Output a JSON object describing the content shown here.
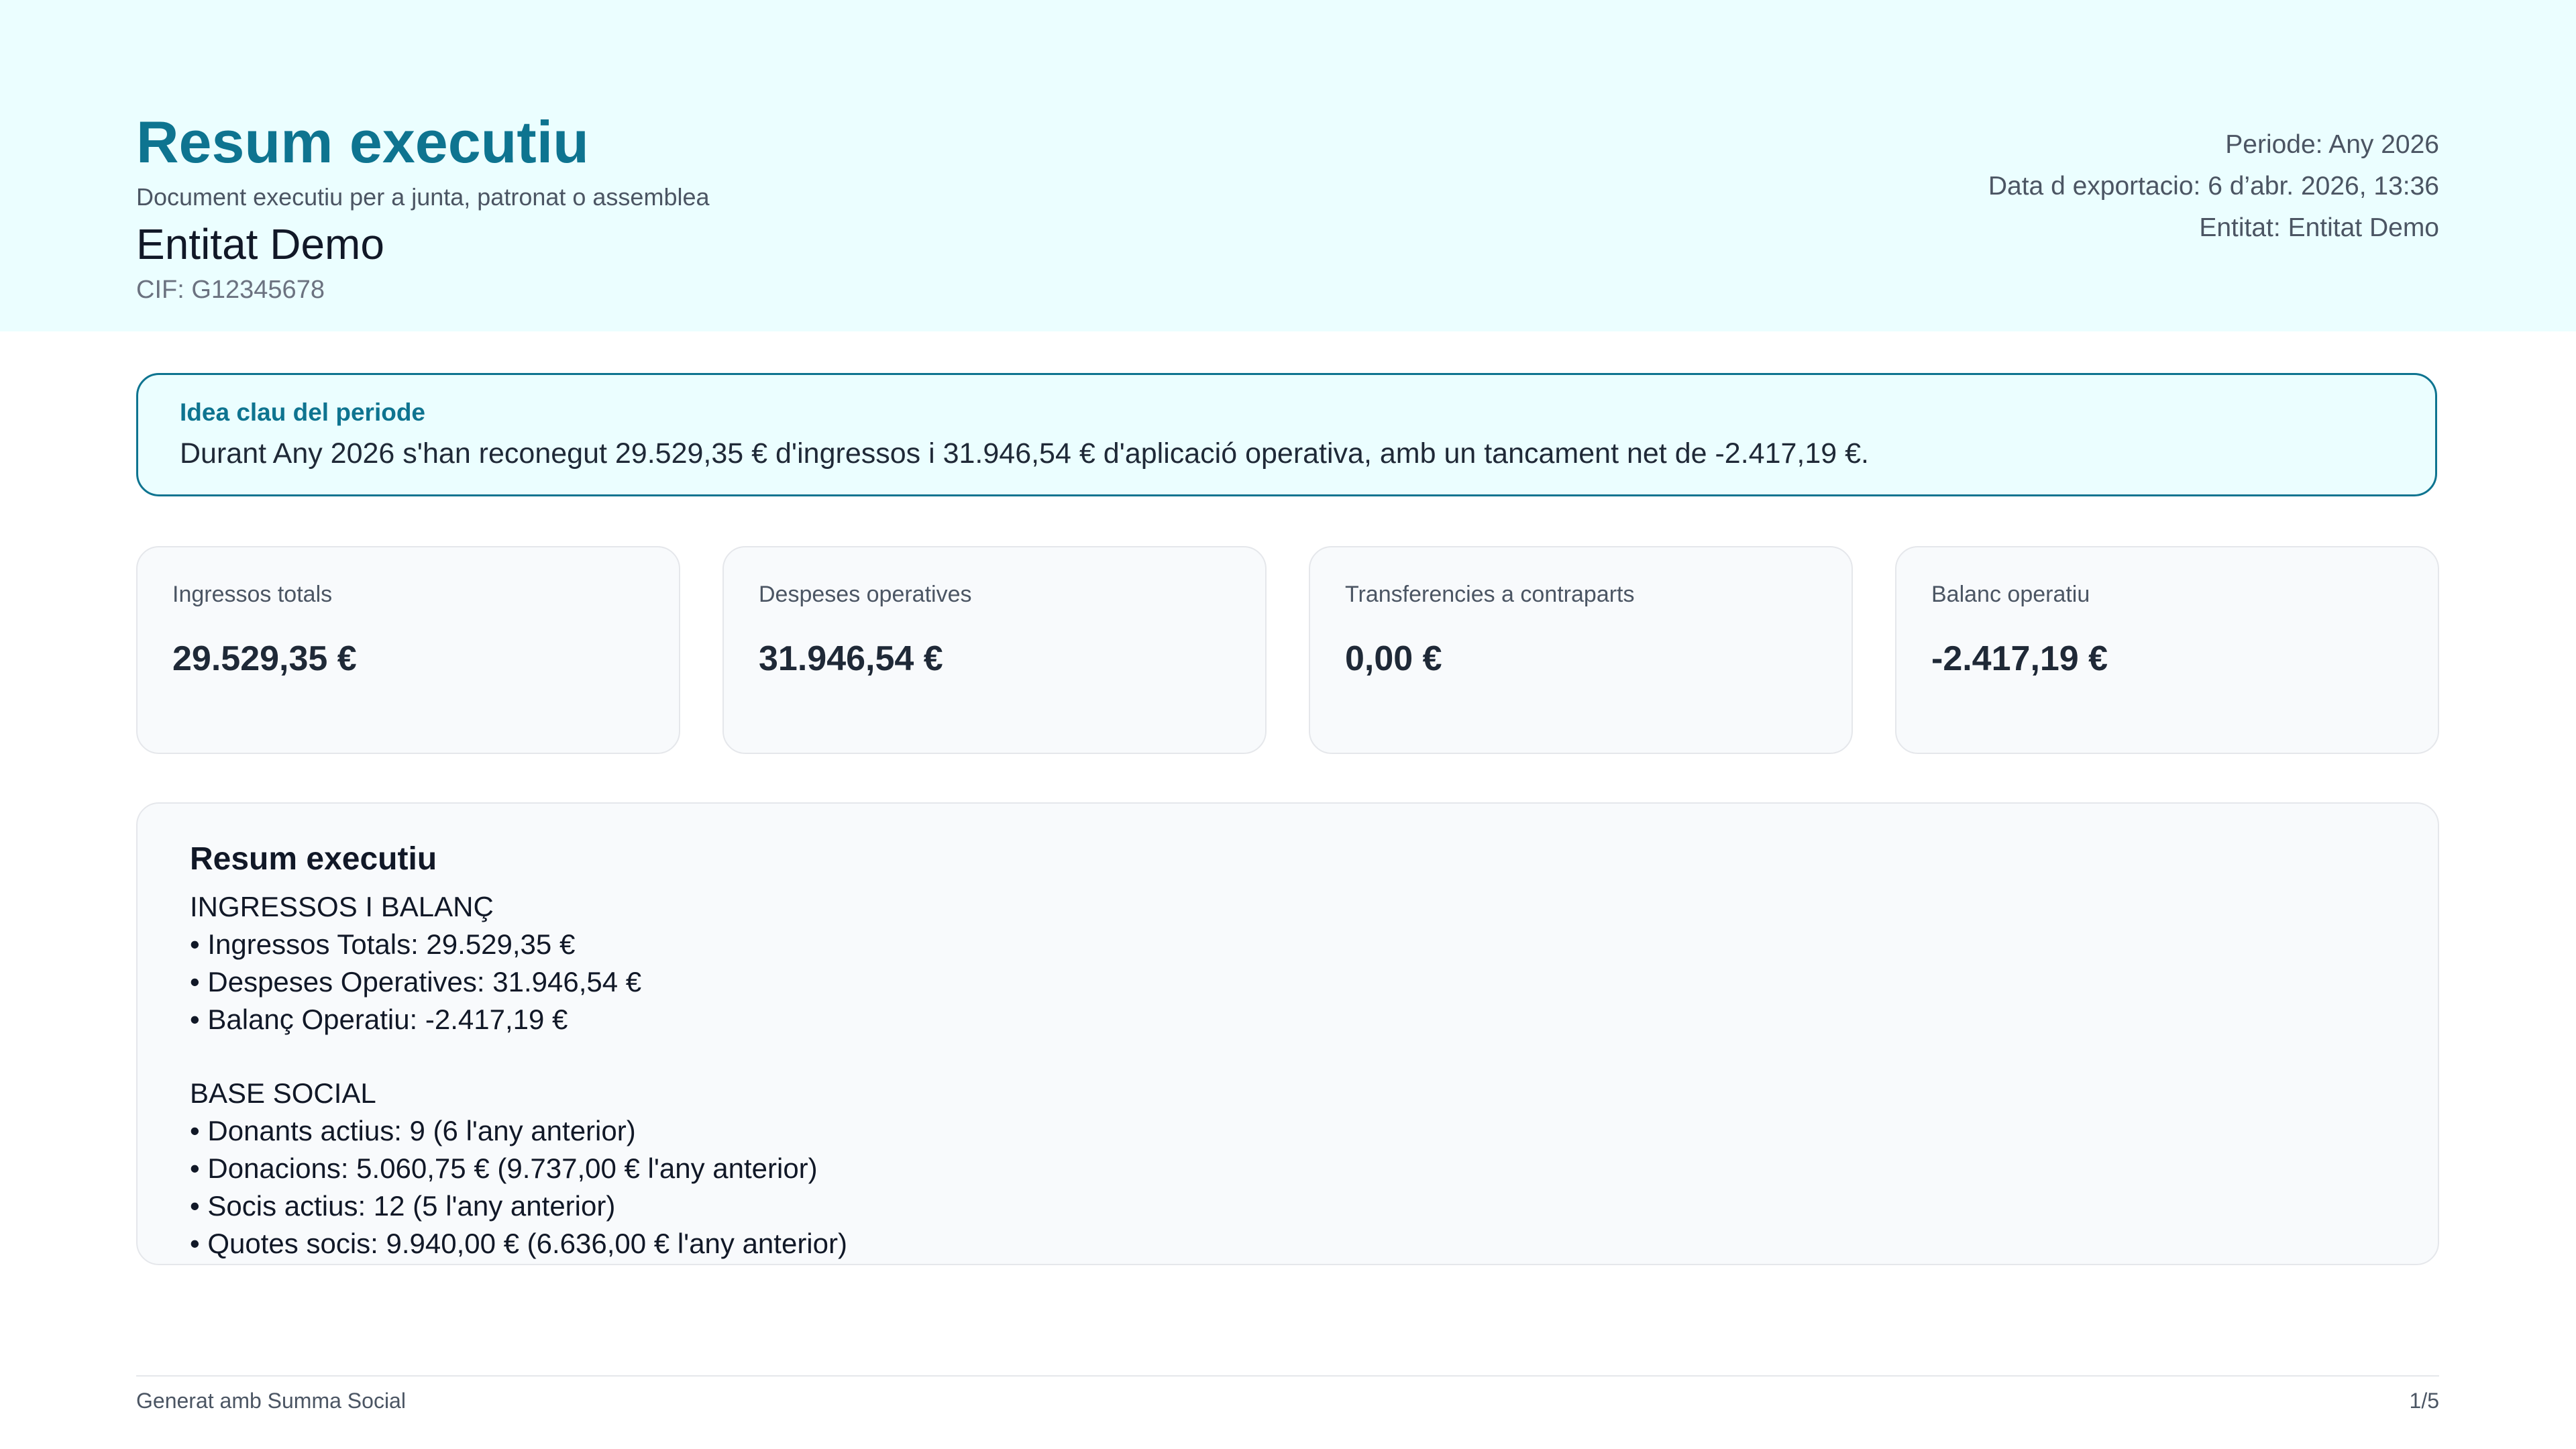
{
  "header": {
    "title": "Resum executiu",
    "subtitle": "Document executiu per a junta, patronat o assemblea",
    "entity_name": "Entitat Demo",
    "cif": "CIF: G12345678",
    "meta": {
      "period": "Periode: Any 2026",
      "export_date": "Data d exportacio: 6 d’abr. 2026, 13:36",
      "entity": "Entitat: Entitat Demo"
    }
  },
  "key_idea": {
    "label": "Idea clau del periode",
    "text": "Durant Any 2026 s'han reconegut 29.529,35 € d'ingressos i 31.946,54 € d'aplicació operativa, amb un tancament net de -2.417,19 €."
  },
  "kpis": [
    {
      "label": "Ingressos totals",
      "value": "29.529,35 €"
    },
    {
      "label": "Despeses operatives",
      "value": "31.946,54 €"
    },
    {
      "label": "Transferencies a contraparts",
      "value": "0,00 €"
    },
    {
      "label": "Balanc operatiu",
      "value": "-2.417,19 €"
    }
  ],
  "summary": {
    "title": "Resum executiu",
    "sections": [
      {
        "heading": "INGRESSOS I BALANÇ",
        "items": [
          "• Ingressos Totals: 29.529,35 €",
          "• Despeses Operatives: 31.946,54 €",
          "• Balanç Operatiu: -2.417,19 €"
        ]
      },
      {
        "heading": "BASE SOCIAL",
        "items": [
          "• Donants actius: 9 (6 l'any anterior)",
          "• Donacions: 5.060,75 € (9.737,00 € l'any anterior)",
          "• Socis actius: 12 (5 l'any anterior)",
          "• Quotes socis: 9.940,00 € (6.636,00 € l'any anterior)"
        ]
      }
    ]
  },
  "footer": {
    "generated": "Generat amb Summa Social",
    "page": "1/5"
  },
  "colors": {
    "accent": "#0e7490",
    "header_bg": "#ebfeff",
    "card_bg": "#f8fafc",
    "card_border": "#e5e7eb"
  }
}
